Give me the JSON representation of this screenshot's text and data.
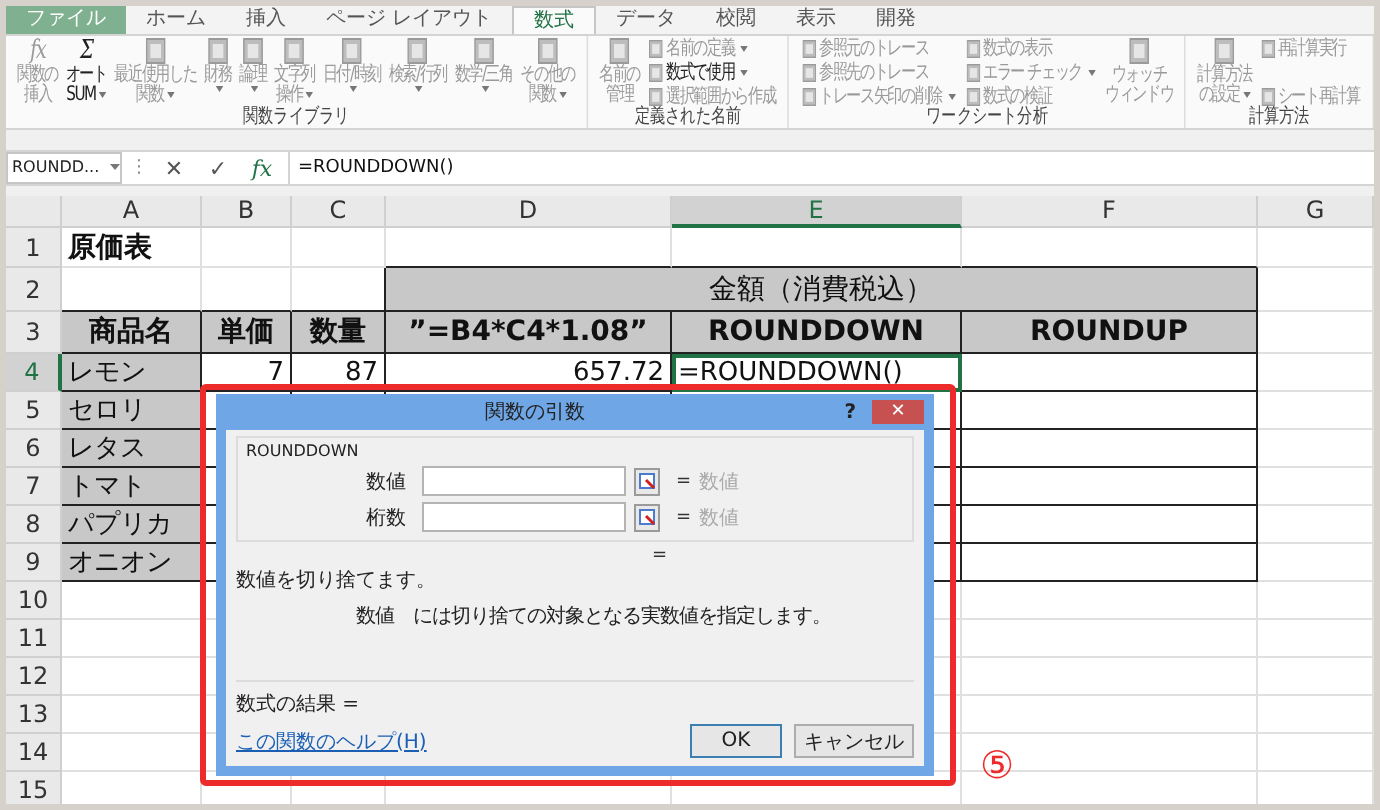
{
  "tabs": [
    {
      "label": "ファイル",
      "selected": false,
      "kind": "file"
    },
    {
      "label": "ホーム",
      "selected": false,
      "kind": "tab"
    },
    {
      "label": "挿入",
      "selected": false,
      "kind": "tab"
    },
    {
      "label": "ページ レイアウト",
      "selected": false,
      "kind": "tab"
    },
    {
      "label": "数式",
      "selected": true,
      "kind": "tab"
    },
    {
      "label": "データ",
      "selected": false,
      "kind": "tab"
    },
    {
      "label": "校閲",
      "selected": false,
      "kind": "tab"
    },
    {
      "label": "表示",
      "selected": false,
      "kind": "tab"
    },
    {
      "label": "開発",
      "selected": false,
      "kind": "tab"
    }
  ],
  "ribbon_groups": [
    {
      "label": "関数ライブラリ",
      "items": [
        {
          "kind": "large",
          "glyph": "fx",
          "lines": [
            "関数の",
            "挿入"
          ],
          "disabled": true,
          "dropdown": false
        },
        {
          "kind": "large",
          "glyph": "Σ",
          "lines": [
            "オート",
            "SUM"
          ],
          "disabled": false,
          "dropdown": true
        },
        {
          "kind": "large",
          "lines": [
            "最近使用した",
            "関数"
          ],
          "disabled": true,
          "dropdown": true
        },
        {
          "kind": "large",
          "lines": [
            "財務"
          ],
          "disabled": true,
          "dropdown": true
        },
        {
          "kind": "large",
          "lines": [
            "論理"
          ],
          "disabled": true,
          "dropdown": true
        },
        {
          "kind": "large",
          "lines": [
            "文字列",
            "操作"
          ],
          "disabled": true,
          "dropdown": true
        },
        {
          "kind": "large",
          "lines": [
            "日付/時刻"
          ],
          "disabled": true,
          "dropdown": true
        },
        {
          "kind": "large",
          "lines": [
            "検索/行列"
          ],
          "disabled": true,
          "dropdown": true
        },
        {
          "kind": "large",
          "lines": [
            "数学/三角"
          ],
          "disabled": true,
          "dropdown": true
        },
        {
          "kind": "large",
          "lines": [
            "その他の",
            "関数"
          ],
          "disabled": true,
          "dropdown": true
        }
      ]
    },
    {
      "label": "定義された名前",
      "items": [
        {
          "kind": "large",
          "lines": [
            "名前の",
            "管理"
          ],
          "disabled": true,
          "dropdown": false
        },
        {
          "kind": "column",
          "entries": [
            {
              "label": "名前の定義",
              "disabled": true,
              "dropdown": true
            },
            {
              "label": "数式で使用",
              "disabled": false,
              "dropdown": true
            },
            {
              "label": "選択範囲から作成",
              "disabled": true,
              "dropdown": false
            }
          ]
        }
      ]
    },
    {
      "label": "ワークシート分析",
      "items": [
        {
          "kind": "column",
          "entries": [
            {
              "label": "参照元のトレース",
              "disabled": true,
              "dropdown": false
            },
            {
              "label": "参照先のトレース",
              "disabled": true,
              "dropdown": false
            },
            {
              "label": "トレース矢印の削除",
              "disabled": true,
              "dropdown": true
            }
          ]
        },
        {
          "kind": "column",
          "entries": [
            {
              "label": "数式の表示",
              "disabled": true,
              "dropdown": false
            },
            {
              "label": "エラー チェック",
              "disabled": true,
              "dropdown": true
            },
            {
              "label": "数式の検証",
              "disabled": true,
              "dropdown": false
            }
          ]
        },
        {
          "kind": "large",
          "lines": [
            "ウォッチ",
            "ウィンドウ"
          ],
          "disabled": true,
          "dropdown": false
        }
      ]
    },
    {
      "label": "計算方法",
      "items": [
        {
          "kind": "large",
          "lines": [
            "計算方法",
            "の設定"
          ],
          "disabled": true,
          "dropdown": true
        },
        {
          "kind": "column",
          "entries": [
            {
              "label": "再計算実行",
              "disabled": true,
              "dropdown": false
            },
            {
              "label": "シート再計算",
              "disabled": true,
              "dropdown": false
            }
          ]
        }
      ]
    }
  ],
  "formula_bar": {
    "name_box": "ROUNDD...",
    "separator": "⋮",
    "buttons": [
      "✕",
      "✓",
      "fx"
    ],
    "formula": "=ROUNDDOWN()"
  },
  "columns": [
    {
      "label": "A",
      "selected": false
    },
    {
      "label": "B",
      "selected": false
    },
    {
      "label": "C",
      "selected": false
    },
    {
      "label": "D",
      "selected": false
    },
    {
      "label": "E",
      "selected": true
    },
    {
      "label": "F",
      "selected": false
    },
    {
      "label": "G",
      "selected": false
    }
  ],
  "rows": [
    {
      "number": "1",
      "selected": false,
      "cells": {
        "A": "原価表"
      }
    },
    {
      "number": "2",
      "selected": false,
      "cells": {
        "D": "金額（消費税込）"
      }
    },
    {
      "number": "3",
      "selected": false,
      "cells": {
        "A": "商品名",
        "B": "単価",
        "C": "数量",
        "D": "”=B4*C4*1.08”",
        "E": "ROUNDDOWN",
        "F": "ROUNDUP"
      }
    },
    {
      "number": "4",
      "selected": true,
      "cells": {
        "A": "レモン",
        "B": "7",
        "C": "87",
        "D": "657.72",
        "E": {
          "text": "=ROUNDDOWN()",
          "selected": true
        }
      }
    },
    {
      "number": "5",
      "selected": false,
      "cells": {
        "A": "セロリ"
      }
    },
    {
      "number": "6",
      "selected": false,
      "cells": {
        "A": "レタス"
      }
    },
    {
      "number": "7",
      "selected": false,
      "cells": {
        "A": "トマト"
      }
    },
    {
      "number": "8",
      "selected": false,
      "cells": {
        "A": "パプリカ"
      }
    },
    {
      "number": "9",
      "selected": false,
      "cells": {
        "A": "オニオン"
      }
    },
    {
      "number": "10",
      "selected": false,
      "cells": {}
    },
    {
      "number": "11",
      "selected": false,
      "cells": {}
    },
    {
      "number": "12",
      "selected": false,
      "cells": {}
    },
    {
      "number": "13",
      "selected": false,
      "cells": {}
    },
    {
      "number": "14",
      "selected": false,
      "cells": {}
    },
    {
      "number": "15",
      "selected": false,
      "cells": {}
    }
  ],
  "dialog": {
    "title": "関数の引数",
    "help": "?",
    "close": "✕",
    "function": "ROUNDDOWN",
    "args": [
      {
        "label": "数値",
        "eq": "=",
        "result": "数値"
      },
      {
        "label": "桁数",
        "eq": "=",
        "result": "数値"
      }
    ],
    "result_eq": "=",
    "description": "数値を切り捨てます。",
    "arg_description": "数値　には切り捨ての対象となる実数値を指定します。",
    "formula_result": "数式の結果 =",
    "help_link": "この関数のヘルプ(H)",
    "buttons": [
      "OK",
      "キャンセル"
    ]
  },
  "callout": {
    "number": "⑤"
  }
}
